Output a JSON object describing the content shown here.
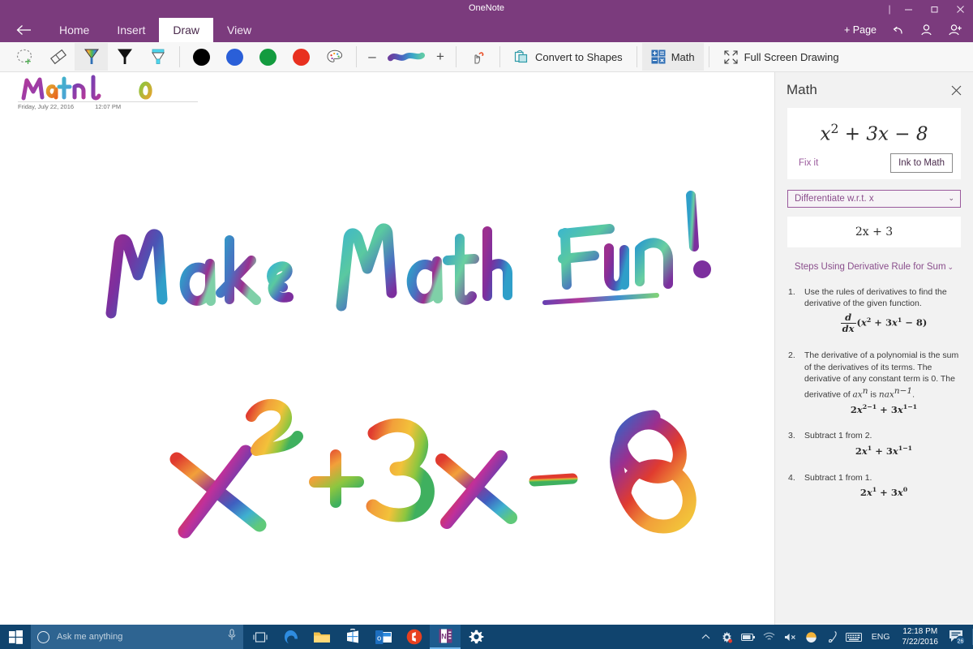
{
  "window": {
    "app_title": "OneNote",
    "controls": {
      "minimize": "–",
      "maximize": "❐",
      "close": "✕"
    }
  },
  "ribbon": {
    "back_label": "←",
    "tabs": [
      {
        "label": "Home",
        "active": false
      },
      {
        "label": "Insert",
        "active": false
      },
      {
        "label": "Draw",
        "active": true
      },
      {
        "label": "View",
        "active": false
      }
    ],
    "right_items": [
      {
        "label": "+ Page",
        "icon": "plus-icon"
      },
      {
        "label": "",
        "icon": "undo-icon"
      },
      {
        "label": "",
        "icon": "person-icon"
      },
      {
        "label": "",
        "icon": "person-add-icon"
      }
    ]
  },
  "toolbar": {
    "tools": [
      {
        "name": "lasso-select",
        "selected": false
      },
      {
        "name": "eraser",
        "selected": false
      },
      {
        "name": "rainbow-pen",
        "selected": true
      },
      {
        "name": "black-pen",
        "selected": false
      },
      {
        "name": "highlighter",
        "selected": false
      }
    ],
    "colors": [
      {
        "name": "black",
        "hex": "#000000"
      },
      {
        "name": "blue",
        "hex": "#2a5fd8"
      },
      {
        "name": "green",
        "hex": "#139b3f"
      },
      {
        "name": "red",
        "hex": "#e8301f"
      }
    ],
    "more_colors_label": "palette-icon",
    "thickness_minus": "–",
    "thickness_plus": "+",
    "commands": [
      {
        "label": "Convert to Shapes",
        "icon": "convert-to-shapes-icon",
        "selected": false
      },
      {
        "label": "Math",
        "icon": "math-icon",
        "selected": true
      },
      {
        "label": "Full Screen Drawing",
        "icon": "full-screen-icon",
        "selected": false
      }
    ],
    "ink_mode_icon": "ink-to-text-pointer-icon"
  },
  "page": {
    "title": "Math 101",
    "date": "Friday, July 22, 2016",
    "time": "12:07 PM",
    "ink_note": "Make Math Fun!",
    "ink_equation": "x² + 3x - 8"
  },
  "math_panel": {
    "title": "Math",
    "close_label": "✕",
    "equation": {
      "base": "x",
      "exponent": "2",
      "rest": " + 3x − 8",
      "display": "x² + 3x − 8"
    },
    "fix_it_label": "Fix it",
    "ink_to_math_label": "Ink to Math",
    "operation_selected": "Differentiate w.r.t. x",
    "result": "2x + 3",
    "steps_header": "Steps Using Derivative Rule for Sum",
    "steps": [
      {
        "number": "1.",
        "text": "Use the rules of derivatives to find the derivative of the given function.",
        "equation": "d/dx (x² + 3x¹ − 8)"
      },
      {
        "number": "2.",
        "text_part1": "The derivative of a polynomial is the sum of the derivatives of its terms. The derivative of any constant term is 0. The derivative of ",
        "text_math1": "ax",
        "text_math1_sup": "n",
        "text_part2": " is ",
        "text_math2": "nax",
        "text_math2_sup": "n−1",
        "text_part3": ".",
        "equation": "2x²⁻¹ + 3x¹⁻¹"
      },
      {
        "number": "3.",
        "text": "Subtract 1 from 2.",
        "equation": "2x¹ + 3x¹⁻¹"
      },
      {
        "number": "4.",
        "text": "Subtract 1 from 1.",
        "equation": "2x¹ + 3x⁰"
      }
    ]
  },
  "taskbar": {
    "start_label": "start-icon",
    "search_placeholder": "Ask me anything",
    "mic_label": "microphone-icon",
    "task_view_label": "task-view-icon",
    "apps": [
      {
        "name": "edge",
        "active": false
      },
      {
        "name": "file-explorer",
        "active": false
      },
      {
        "name": "store",
        "active": false
      },
      {
        "name": "outlook",
        "active": false
      },
      {
        "name": "office",
        "active": false
      },
      {
        "name": "onenote",
        "active": true
      },
      {
        "name": "settings",
        "active": false
      }
    ],
    "tray": [
      {
        "name": "show-hidden-icons",
        "glyph": "⌃"
      },
      {
        "name": "action-center-settings",
        "glyph": "✲"
      },
      {
        "name": "battery",
        "glyph": "▭"
      },
      {
        "name": "wifi",
        "glyph": "◔"
      },
      {
        "name": "volume-muted",
        "glyph": "🔇"
      },
      {
        "name": "weather",
        "glyph": "☀"
      },
      {
        "name": "pen",
        "glyph": "✒"
      },
      {
        "name": "keyboard",
        "glyph": "⌨"
      }
    ],
    "language": "ENG",
    "clock_time": "12:18 PM",
    "clock_date": "7/22/2016",
    "notification_count": "26"
  },
  "colors": {
    "brand_purple": "#7b3b7d",
    "panel_bg": "#f2f2f2",
    "toolbar_bg": "#f7f7f7",
    "taskbar_bg": "#10446e",
    "accent_link": "#8a4e8c"
  }
}
